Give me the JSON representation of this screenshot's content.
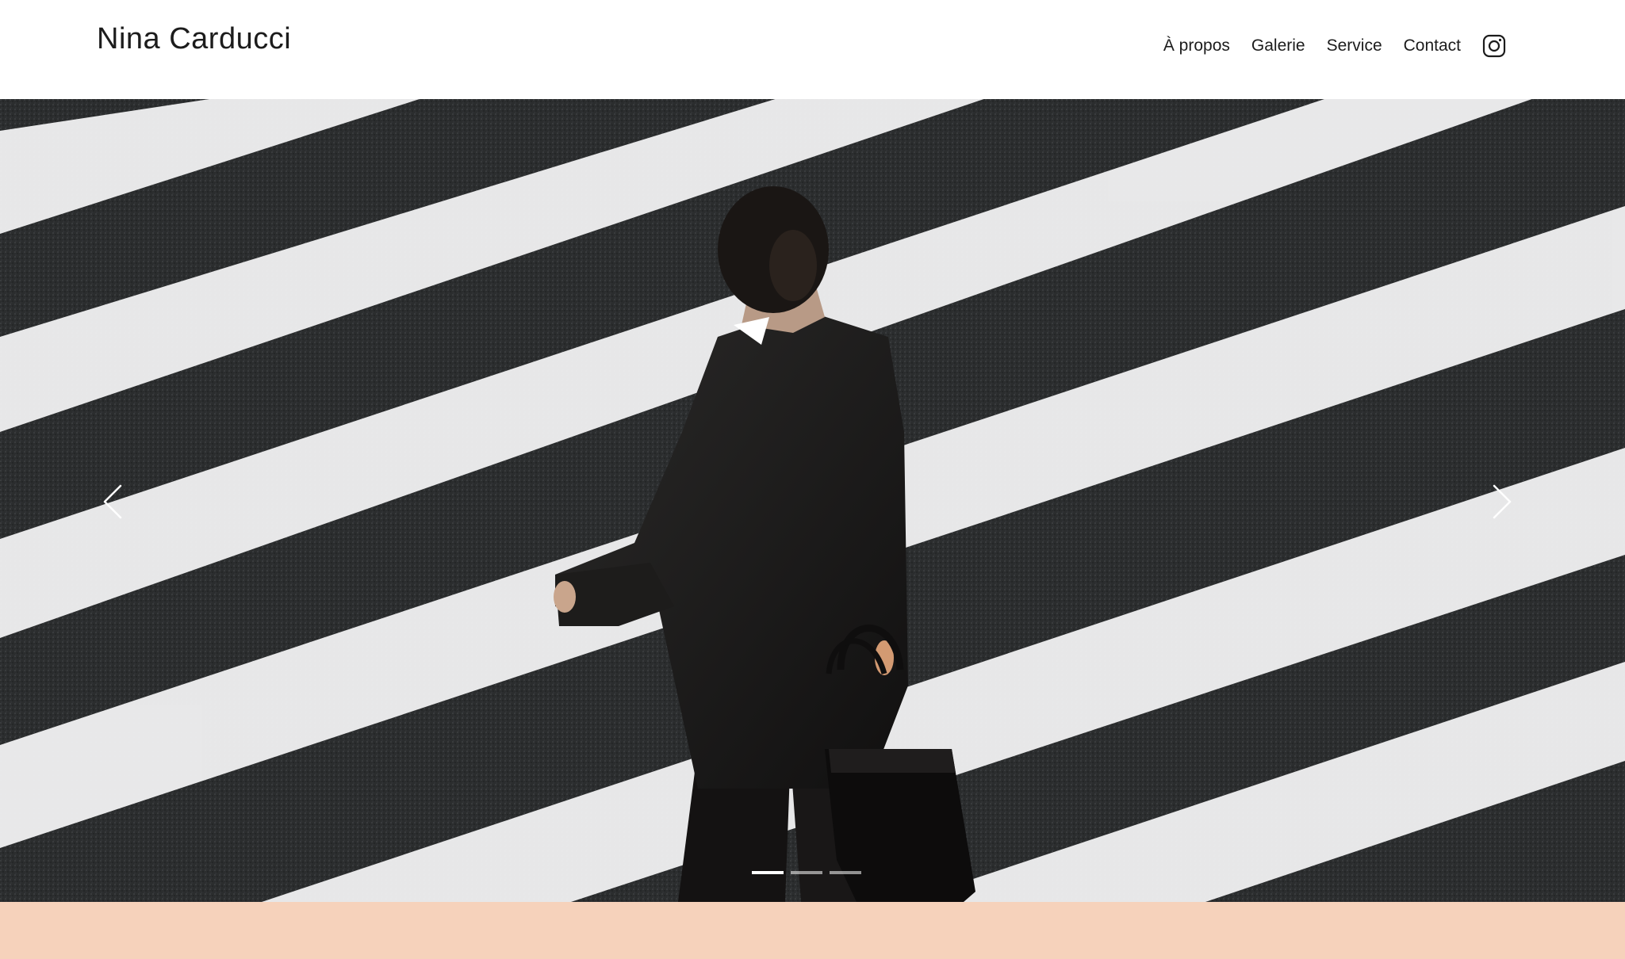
{
  "site": {
    "title": "Nina Carducci"
  },
  "nav": {
    "items": [
      {
        "label": "À propos"
      },
      {
        "label": "Galerie"
      },
      {
        "label": "Service"
      },
      {
        "label": "Contact"
      }
    ],
    "social_icon": "instagram-icon"
  },
  "hero": {
    "slide_count": 3,
    "active_slide": 1,
    "prev_icon": "chevron-left-icon",
    "next_icon": "chevron-right-icon"
  },
  "colors": {
    "band": "#f6d2bb",
    "text": "#1c1c1c",
    "asphalt": "#2a2c2d",
    "stripe": "#f1f1f2"
  }
}
